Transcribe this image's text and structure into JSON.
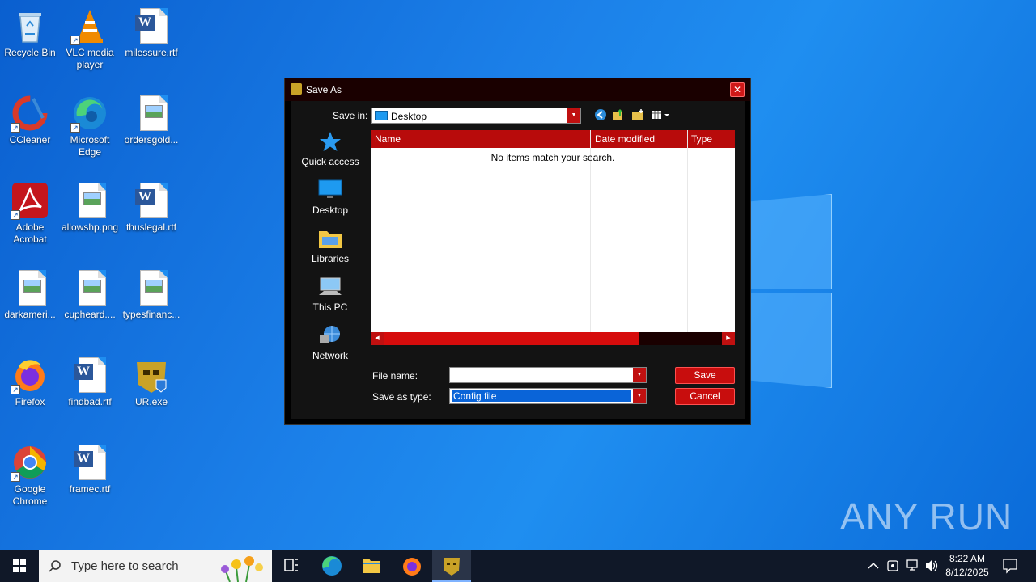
{
  "desktop": {
    "icons": [
      {
        "label": "Recycle Bin"
      },
      {
        "label": "VLC media player"
      },
      {
        "label": "milessure.rtf"
      },
      {
        "label": "CCleaner"
      },
      {
        "label": "Microsoft Edge"
      },
      {
        "label": "ordersgold..."
      },
      {
        "label": "Adobe Acrobat"
      },
      {
        "label": "allowshp.png"
      },
      {
        "label": "thuslegal.rtf"
      },
      {
        "label": "darkameri..."
      },
      {
        "label": "cupheard...."
      },
      {
        "label": "typesfinanc..."
      },
      {
        "label": "Firefox"
      },
      {
        "label": "findbad.rtf"
      },
      {
        "label": "UR.exe"
      },
      {
        "label": "Google Chrome"
      },
      {
        "label": "framec.rtf"
      }
    ]
  },
  "dialog": {
    "title": "Save As",
    "close_glyph": "✕",
    "save_in_label": "Save in:",
    "save_in_value": "Desktop",
    "places": [
      {
        "label": "Quick access"
      },
      {
        "label": "Desktop"
      },
      {
        "label": "Libraries"
      },
      {
        "label": "This PC"
      },
      {
        "label": "Network"
      }
    ],
    "columns": [
      "Name",
      "Date modified",
      "Type"
    ],
    "empty_message": "No items match your search.",
    "file_name_label": "File name:",
    "file_name_value": "",
    "save_as_type_label": "Save as type:",
    "save_as_type_value": "Config file",
    "save_button": "Save",
    "cancel_button": "Cancel",
    "accent_color": "#c80d0d"
  },
  "taskbar": {
    "search_placeholder": "Type here to search",
    "time": "8:22 AM",
    "date": "8/12/2025"
  },
  "watermark": "ANY RUN"
}
